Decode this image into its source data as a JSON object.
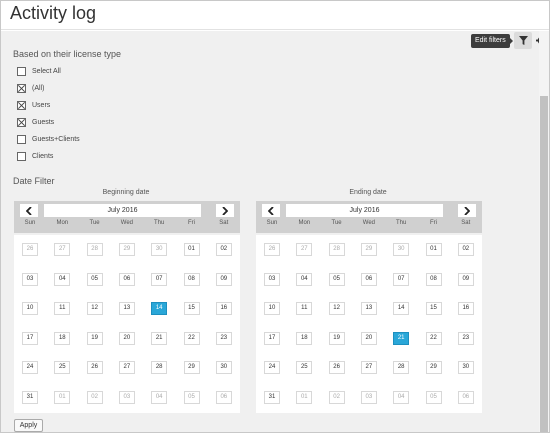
{
  "header": {
    "title": "Activity log"
  },
  "toolbar": {
    "tooltip": "Edit filters",
    "filter_icon": "filter-icon",
    "settings_icon": "gear-icon"
  },
  "license_filter": {
    "label": "Based on their license type",
    "options": [
      {
        "label": "Select All",
        "checked": false
      },
      {
        "label": "(All)",
        "checked": true
      },
      {
        "label": "Users",
        "checked": true
      },
      {
        "label": "Guests",
        "checked": true
      },
      {
        "label": "Guests+Clients",
        "checked": false
      },
      {
        "label": "Clients",
        "checked": false
      }
    ]
  },
  "date_filter": {
    "label": "Date Filter",
    "weekdays": [
      "Sun",
      "Mon",
      "Tue",
      "Wed",
      "Thu",
      "Fri",
      "Sat"
    ],
    "prev_icon": "chevron-left-icon",
    "next_icon": "chevron-right-icon",
    "beginning": {
      "title": "Beginning date",
      "month": "July 2016",
      "weeks": [
        [
          "26",
          "27",
          "28",
          "29",
          "30",
          "01",
          "02"
        ],
        [
          "03",
          "04",
          "05",
          "06",
          "07",
          "08",
          "09"
        ],
        [
          "10",
          "11",
          "12",
          "13",
          "14",
          "15",
          "16"
        ],
        [
          "17",
          "18",
          "19",
          "20",
          "21",
          "22",
          "23"
        ],
        [
          "24",
          "25",
          "26",
          "27",
          "28",
          "29",
          "30"
        ],
        [
          "31",
          "01",
          "02",
          "03",
          "04",
          "05",
          "06"
        ]
      ],
      "selected": "14"
    },
    "ending": {
      "title": "Ending date",
      "month": "July 2016",
      "weeks": [
        [
          "26",
          "27",
          "28",
          "29",
          "30",
          "01",
          "02"
        ],
        [
          "03",
          "04",
          "05",
          "06",
          "07",
          "08",
          "09"
        ],
        [
          "10",
          "11",
          "12",
          "13",
          "14",
          "15",
          "16"
        ],
        [
          "17",
          "18",
          "19",
          "20",
          "21",
          "22",
          "23"
        ],
        [
          "24",
          "25",
          "26",
          "27",
          "28",
          "29",
          "30"
        ],
        [
          "31",
          "01",
          "02",
          "03",
          "04",
          "05",
          "06"
        ]
      ],
      "selected": "21"
    }
  },
  "apply_label": "Apply"
}
